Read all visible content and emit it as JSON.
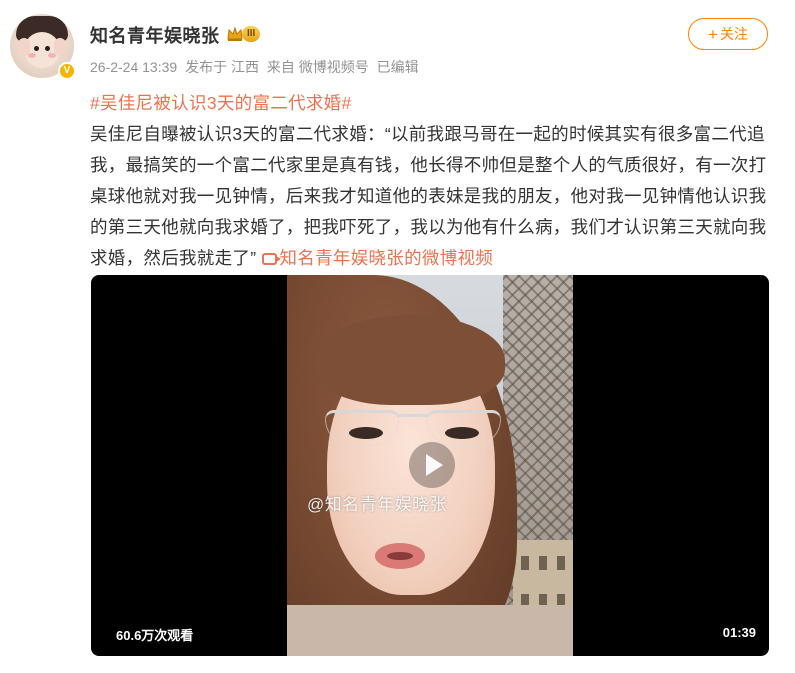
{
  "author": {
    "name": "知名青年娱晓张",
    "vip_level": "III"
  },
  "follow_button": {
    "label": "关注"
  },
  "meta": {
    "date": "26-2-24 13:39",
    "location": "发布于 江西",
    "source": "来自 微博视频号",
    "edited": "已编辑"
  },
  "post": {
    "hashtag": "#吴佳尼被认识3天的富二代求婚#",
    "body": "吴佳尼自曝被认识3天的富二代求婚：“以前我跟马哥在一起的时候其实有很多富二代追我，最搞笑的一个富二代家里是真有钱，他长得不帅但是整个人的气质很好，有一次打桌球他就对我一见钟情，后来我才知道他的表妹是我的朋友，他对我一见钟情他认识我的第三天他就向我求婚了，把我吓死了，我以为他有什么病，我们才认识第三天就向我求婚，然后我就走了”",
    "video_link": "知名青年娱晓张的微博视频"
  },
  "video": {
    "watermark": "@知名青年娱晓张",
    "views": "60.6万次观看",
    "duration": "01:39"
  },
  "colors": {
    "accent": "#ff8200",
    "link": "#eb7350",
    "meta": "#939393"
  },
  "icons": [
    "verified-icon",
    "crown-icon",
    "plus-icon",
    "video-link-icon",
    "play-icon"
  ]
}
